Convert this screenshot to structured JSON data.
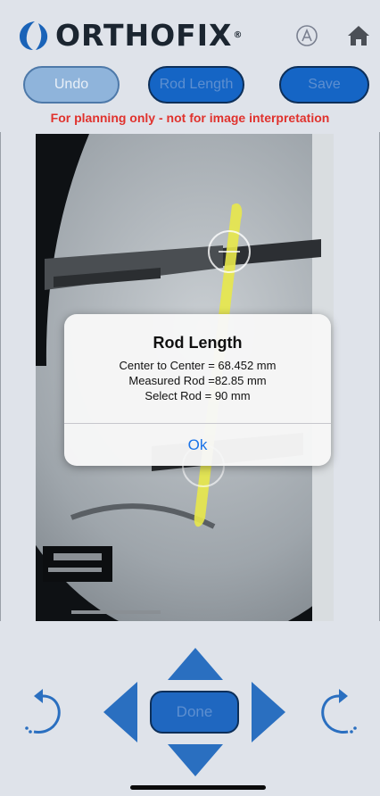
{
  "header": {
    "brand": "ORTHOFIX",
    "brand_mark": "®",
    "icons": {
      "accessibility": "a-circle-icon",
      "home": "home-icon"
    }
  },
  "toolbar": {
    "undo_label": "Undo",
    "rod_length_label": "Rod Length",
    "save_label": "Save"
  },
  "disclaimer": "For planning only - not for image interpretation",
  "dialog": {
    "title": "Rod Length",
    "center_to_center": "Center to Center = 68.452 mm",
    "measured_rod": "Measured Rod =82.85 mm",
    "select_rod": "Select Rod = 90 mm",
    "ok_label": "Ok"
  },
  "controls": {
    "done_label": "Done",
    "icons": [
      "rotate-left-icon",
      "arrow-left-icon",
      "arrow-up-icon",
      "arrow-down-icon",
      "arrow-right-icon",
      "rotate-right-icon"
    ]
  },
  "colors": {
    "accent_blue": "#1565c5",
    "warning_red": "#e0322d",
    "rod_yellow": "#e8e84a",
    "background": "#dfe3ea"
  }
}
